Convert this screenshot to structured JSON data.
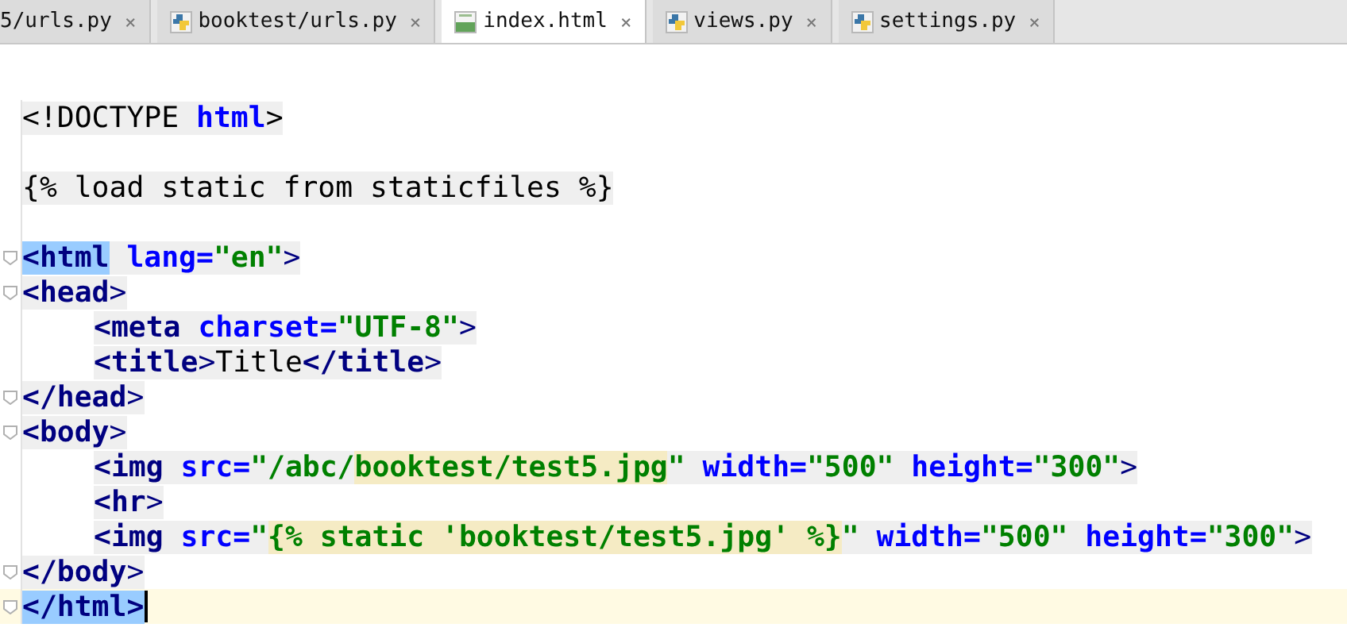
{
  "tabs": [
    {
      "label": "5/urls.py",
      "close": "×",
      "selected": false
    },
    {
      "label": "booktest/urls.py",
      "kind": "python",
      "close": "×",
      "selected": false
    },
    {
      "label": "index.html",
      "kind": "html",
      "close": "×",
      "selected": true
    },
    {
      "label": "views.py",
      "kind": "python",
      "close": "×",
      "selected": false
    },
    {
      "label": "settings.py",
      "kind": "python",
      "close": "×",
      "selected": false
    }
  ],
  "lines": [
    {
      "fold": false,
      "current": false,
      "tokens": [
        {
          "kind": "plain",
          "text": "<!DOCTYPE "
        },
        {
          "kind": "attr",
          "text": "html"
        },
        {
          "kind": "plain",
          "text": ">"
        }
      ]
    },
    {
      "fold": false,
      "current": false
    },
    {
      "fold": false,
      "current": false,
      "tokens": [
        {
          "kind": "plain",
          "text": "{% load static from staticfiles %}"
        }
      ]
    },
    {
      "fold": false,
      "current": false
    },
    {
      "fold": true,
      "current": false,
      "tokens": [
        {
          "kind": "tag",
          "text": "<html",
          "matched": true
        },
        {
          "kind": "attr",
          "text": " lang="
        },
        {
          "kind": "string",
          "text": "\"en\""
        },
        {
          "kind": "punct",
          "text": ">"
        }
      ]
    },
    {
      "fold": true,
      "current": false,
      "tokens": [
        {
          "kind": "tag",
          "text": "<head"
        },
        {
          "kind": "punct",
          "text": ">"
        }
      ]
    },
    {
      "fold": false,
      "current": false,
      "indent": true,
      "tokens": [
        {
          "kind": "tag",
          "text": "<meta"
        },
        {
          "kind": "attr",
          "text": " charset="
        },
        {
          "kind": "string",
          "text": "\"UTF-8\""
        },
        {
          "kind": "punct",
          "text": ">"
        }
      ]
    },
    {
      "fold": false,
      "current": false,
      "indent": true,
      "tokens": [
        {
          "kind": "tag",
          "text": "<title"
        },
        {
          "kind": "punct",
          "text": ">"
        },
        {
          "kind": "plain",
          "text": "Title"
        },
        {
          "kind": "tag",
          "text": "</title"
        },
        {
          "kind": "punct",
          "text": ">"
        }
      ]
    },
    {
      "fold": true,
      "current": false,
      "tokens": [
        {
          "kind": "tag",
          "text": "</head"
        },
        {
          "kind": "punct",
          "text": ">"
        }
      ]
    },
    {
      "fold": true,
      "current": false,
      "tokens": [
        {
          "kind": "tag",
          "text": "<body"
        },
        {
          "kind": "punct",
          "text": ">"
        }
      ]
    },
    {
      "fold": false,
      "current": false,
      "indent": true,
      "tokens": [
        {
          "kind": "tag",
          "text": "<img"
        },
        {
          "kind": "attr",
          "text": " src="
        },
        {
          "kind": "string",
          "text": "\"/abc/"
        },
        {
          "kind": "ref",
          "text": "booktest/test5.jpg"
        },
        {
          "kind": "string",
          "text": "\""
        },
        {
          "kind": "attr",
          "text": " width="
        },
        {
          "kind": "string",
          "text": "\"500\""
        },
        {
          "kind": "attr",
          "text": " height="
        },
        {
          "kind": "string",
          "text": "\"300\""
        },
        {
          "kind": "punct",
          "text": ">"
        }
      ]
    },
    {
      "fold": false,
      "current": false,
      "indent": true,
      "tokens": [
        {
          "kind": "tag",
          "text": "<hr"
        },
        {
          "kind": "punct",
          "text": ">"
        }
      ]
    },
    {
      "fold": false,
      "current": false,
      "indent": true,
      "tokens": [
        {
          "kind": "tag",
          "text": "<img"
        },
        {
          "kind": "attr",
          "text": " src="
        },
        {
          "kind": "string",
          "text": "\""
        },
        {
          "kind": "ref",
          "text": "{% static 'booktest/test5.jpg' %}"
        },
        {
          "kind": "string",
          "text": "\""
        },
        {
          "kind": "attr",
          "text": " width="
        },
        {
          "kind": "string",
          "text": "\"500\""
        },
        {
          "kind": "attr",
          "text": " height="
        },
        {
          "kind": "string",
          "text": "\"300\""
        },
        {
          "kind": "punct",
          "text": ">"
        }
      ]
    },
    {
      "fold": true,
      "current": false,
      "tokens": [
        {
          "kind": "tag",
          "text": "</body"
        },
        {
          "kind": "punct",
          "text": ">"
        }
      ]
    },
    {
      "fold": true,
      "current": true,
      "tokens": [
        {
          "kind": "tag",
          "text": "</html>",
          "matched": true
        }
      ]
    }
  ]
}
